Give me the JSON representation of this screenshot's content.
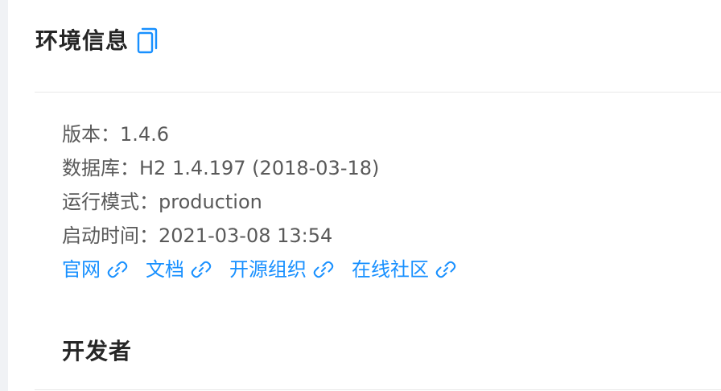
{
  "env_card": {
    "title": "环境信息",
    "copy_icon": "copy-icon",
    "version_label": "版本：",
    "version_value": "1.4.6",
    "database_label": "数据库：",
    "database_value": "H2 1.4.197 (2018-03-18)",
    "mode_label": "运行模式：",
    "mode_value": "production",
    "start_time_label": "启动时间：",
    "start_time_value": "2021-03-08 13:54",
    "links": [
      {
        "label": "官网",
        "icon": "link-icon"
      },
      {
        "label": "文档",
        "icon": "link-icon"
      },
      {
        "label": "开源组织",
        "icon": "link-icon"
      },
      {
        "label": "在线社区",
        "icon": "link-icon"
      }
    ]
  },
  "developer_card": {
    "title": "开发者"
  },
  "colors": {
    "accent": "#1890ff",
    "title_text": "#262626",
    "body_text": "#595959",
    "divider": "#e8e8e8",
    "background": "#f0f2f5"
  }
}
